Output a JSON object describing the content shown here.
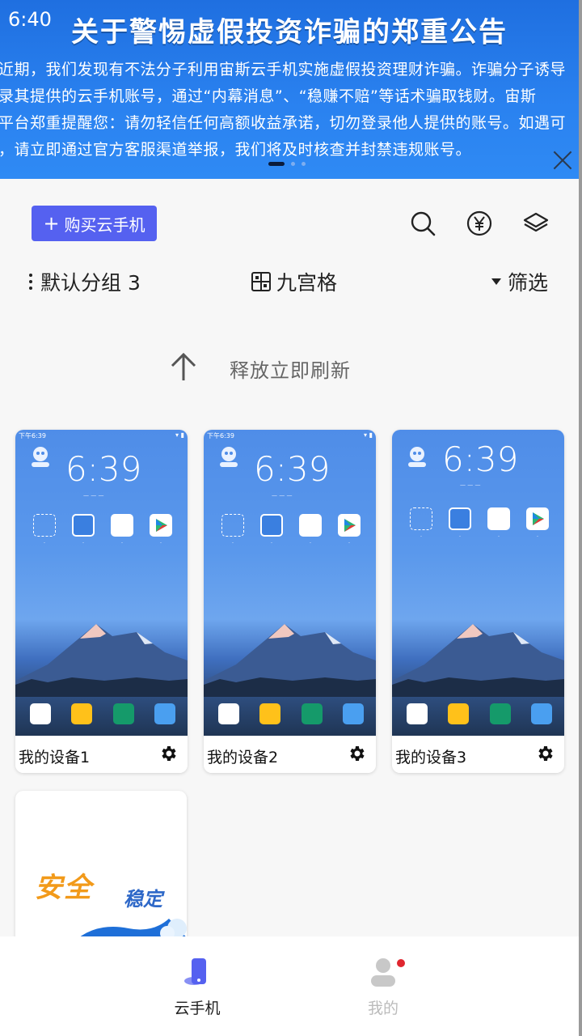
{
  "status_bar": {
    "time": "6:40"
  },
  "banner": {
    "title": "关于警惕虚假投资诈骗的郑重公告",
    "lines": [
      "近期，我们发现有不法分子利用宙斯云手机实施虚假投资理财诈骗。诈骗分子诱导",
      "录其提供的云手机账号，通过“内幕消息”、“稳赚不赔”等话术骗取钱财。宙斯",
      "平台郑重提醒您：请勿轻信任何高额收益承诺，切勿登录他人提供的账号。如遇可",
      "，请立即通过官方客服渠道举报，我们将及时核查并封禁违规账号。"
    ]
  },
  "toolbar": {
    "buy_label": "购买云手机",
    "icons": [
      "search-icon",
      "yuan-icon",
      "layers-icon"
    ]
  },
  "filters": {
    "group_label": "默认分组 3",
    "grid_label": "九宫格",
    "filter_label": "筛选"
  },
  "refresh": {
    "text": "释放立即刷新"
  },
  "devices": [
    {
      "name": "我的设备1",
      "clock": "6:39",
      "status_time": "下午6:39"
    },
    {
      "name": "我的设备2",
      "clock": "6:39",
      "status_time": "下午6:39"
    },
    {
      "name": "我的设备3",
      "clock": "6:39",
      "status_time": ""
    }
  ],
  "promo": {
    "text_a": "安全",
    "text_b": "稳定"
  },
  "bottom_nav": {
    "items": [
      {
        "label": "云手机",
        "active": true
      },
      {
        "label": "我的",
        "active": false,
        "badge": true
      }
    ]
  },
  "colors": {
    "accent": "#5561f0",
    "banner": "#2a82f0",
    "badge": "#e0262f"
  }
}
